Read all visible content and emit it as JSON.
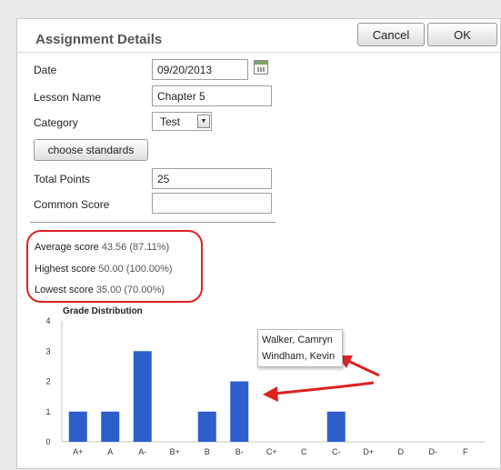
{
  "dialog": {
    "title": "Assignment Details",
    "cancel_label": "Cancel",
    "ok_label": "OK"
  },
  "form": {
    "date_label": "Date",
    "date_value": "09/20/2013",
    "lesson_label": "Lesson Name",
    "lesson_value": "Chapter 5",
    "category_label": "Category",
    "category_value": "Test",
    "standards_label": "choose standards",
    "points_label": "Total Points",
    "points_value": "25",
    "common_label": "Common Score",
    "common_value": ""
  },
  "stats": {
    "average_label": "Average score",
    "average_value": "43.56 (87.11%)",
    "highest_label": "Highest score",
    "highest_value": "50.00 (100.00%)",
    "lowest_label": "Lowest score",
    "lowest_value": "35.00 (70.00%)"
  },
  "tooltip": {
    "line1": "Walker, Camryn",
    "line2": "Windham, Kevin"
  },
  "colors": {
    "bar": "#2d5fcc",
    "annotation": "#dd2222"
  },
  "chart_data": {
    "type": "bar",
    "title": "Grade Distribution",
    "categories": [
      "A+",
      "A",
      "A-",
      "B+",
      "B",
      "B-",
      "C+",
      "C",
      "C-",
      "D+",
      "D",
      "D-",
      "F"
    ],
    "values": [
      1,
      1,
      3,
      0,
      1,
      2,
      0,
      0,
      1,
      0,
      0,
      0,
      0
    ],
    "yticks": [
      0,
      1,
      2,
      3,
      4
    ],
    "ylim": [
      0,
      4
    ],
    "grid": false
  }
}
